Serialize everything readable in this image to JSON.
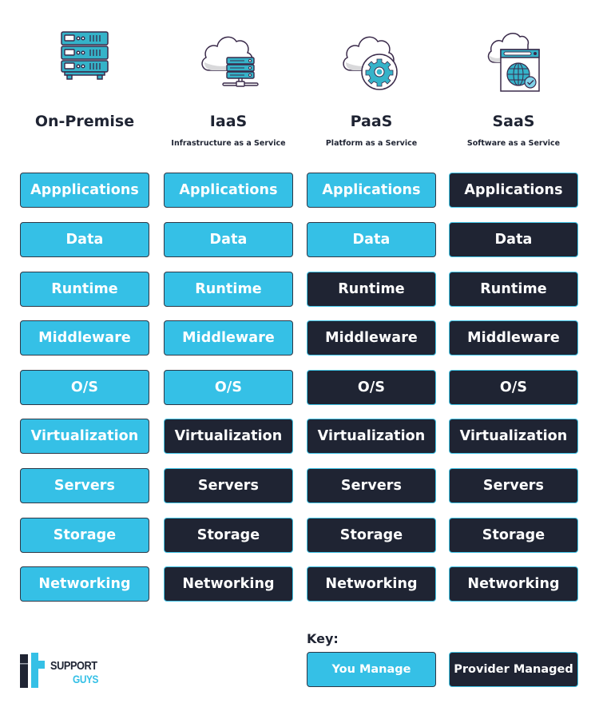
{
  "columns": [
    {
      "title": "On-Premise",
      "subtitle": "",
      "icon": "server-rack-icon"
    },
    {
      "title": "IaaS",
      "subtitle": "Infrastructure as a Service",
      "icon": "cloud-server-icon"
    },
    {
      "title": "PaaS",
      "subtitle": "Platform as a Service",
      "icon": "cloud-gear-icon"
    },
    {
      "title": "SaaS",
      "subtitle": "Software as a Service",
      "icon": "cloud-browser-globe-icon"
    }
  ],
  "layers": [
    {
      "labels": [
        "Appplications",
        "Applications",
        "Applications",
        "Applications"
      ],
      "managed_by": [
        "you",
        "you",
        "you",
        "provider"
      ]
    },
    {
      "labels": [
        "Data",
        "Data",
        "Data",
        "Data"
      ],
      "managed_by": [
        "you",
        "you",
        "you",
        "provider"
      ]
    },
    {
      "labels": [
        "Runtime",
        "Runtime",
        "Runtime",
        "Runtime"
      ],
      "managed_by": [
        "you",
        "you",
        "provider",
        "provider"
      ]
    },
    {
      "labels": [
        "Middleware",
        "Middleware",
        "Middleware",
        "Middleware"
      ],
      "managed_by": [
        "you",
        "you",
        "provider",
        "provider"
      ]
    },
    {
      "labels": [
        "O/S",
        "O/S",
        "O/S",
        "O/S"
      ],
      "managed_by": [
        "you",
        "you",
        "provider",
        "provider"
      ]
    },
    {
      "labels": [
        "Virtualization",
        "Virtualization",
        "Virtualization",
        "Virtualization"
      ],
      "managed_by": [
        "you",
        "provider",
        "provider",
        "provider"
      ]
    },
    {
      "labels": [
        "Servers",
        "Servers",
        "Servers",
        "Servers"
      ],
      "managed_by": [
        "you",
        "provider",
        "provider",
        "provider"
      ]
    },
    {
      "labels": [
        "Storage",
        "Storage",
        "Storage",
        "Storage"
      ],
      "managed_by": [
        "you",
        "provider",
        "provider",
        "provider"
      ]
    },
    {
      "labels": [
        "Networking",
        "Networking",
        "Networking",
        "Networking"
      ],
      "managed_by": [
        "you",
        "provider",
        "provider",
        "provider"
      ]
    }
  ],
  "key": {
    "label": "Key:",
    "you_manage": "You Manage",
    "provider_managed": "Provider Managed"
  },
  "colors": {
    "you_manage": "#35c0e6",
    "provider_managed": "#1f2433",
    "text_dark": "#1f2433"
  },
  "logo": {
    "mark": "it",
    "line1": "SUPPORT",
    "line2": "GUYS"
  }
}
